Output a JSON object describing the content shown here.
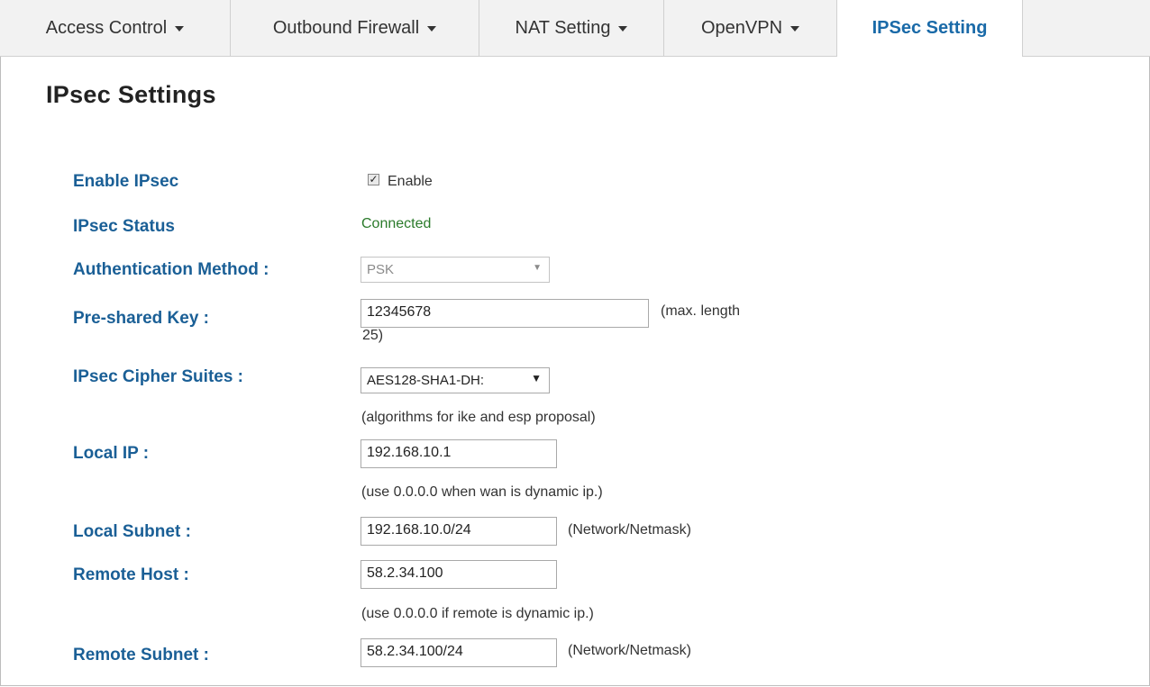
{
  "tabs": [
    {
      "label": "Access Control",
      "dropdown": true
    },
    {
      "label": "Outbound Firewall",
      "dropdown": true
    },
    {
      "label": "NAT Setting",
      "dropdown": true
    },
    {
      "label": "OpenVPN",
      "dropdown": true
    },
    {
      "label": "IPSec Setting",
      "dropdown": false,
      "active": true
    }
  ],
  "page_title": "IPsec Settings",
  "form": {
    "enable": {
      "label": "Enable IPsec",
      "checked": true,
      "checkbox_label": "Enable"
    },
    "status": {
      "label": "IPsec Status",
      "value": "Connected"
    },
    "auth_method": {
      "label": "Authentication Method :",
      "value": "PSK"
    },
    "psk": {
      "label": "Pre-shared Key :",
      "value": "12345678",
      "hint_line1": "(max. length",
      "hint_line2": "25)"
    },
    "cipher": {
      "label": "IPsec Cipher Suites :",
      "value": "AES128-SHA1-DH:",
      "hint": "(algorithms for ike and esp proposal)"
    },
    "local_ip": {
      "label": "Local IP :",
      "value": "192.168.10.1",
      "hint": "(use 0.0.0.0 when wan is dynamic ip.)"
    },
    "local_subnet": {
      "label": "Local Subnet :",
      "value": "192.168.10.0/24",
      "hint": "(Network/Netmask)"
    },
    "remote_host": {
      "label": "Remote Host :",
      "value": "58.2.34.100",
      "hint": "(use 0.0.0.0 if remote is dynamic ip.)"
    },
    "remote_subnet": {
      "label": "Remote Subnet :",
      "value": "58.2.34.100/24",
      "hint": "(Network/Netmask)"
    }
  },
  "colors": {
    "label": "#1a5f96",
    "active_tab": "#1a6aa8",
    "status": "#2a7a2a"
  }
}
